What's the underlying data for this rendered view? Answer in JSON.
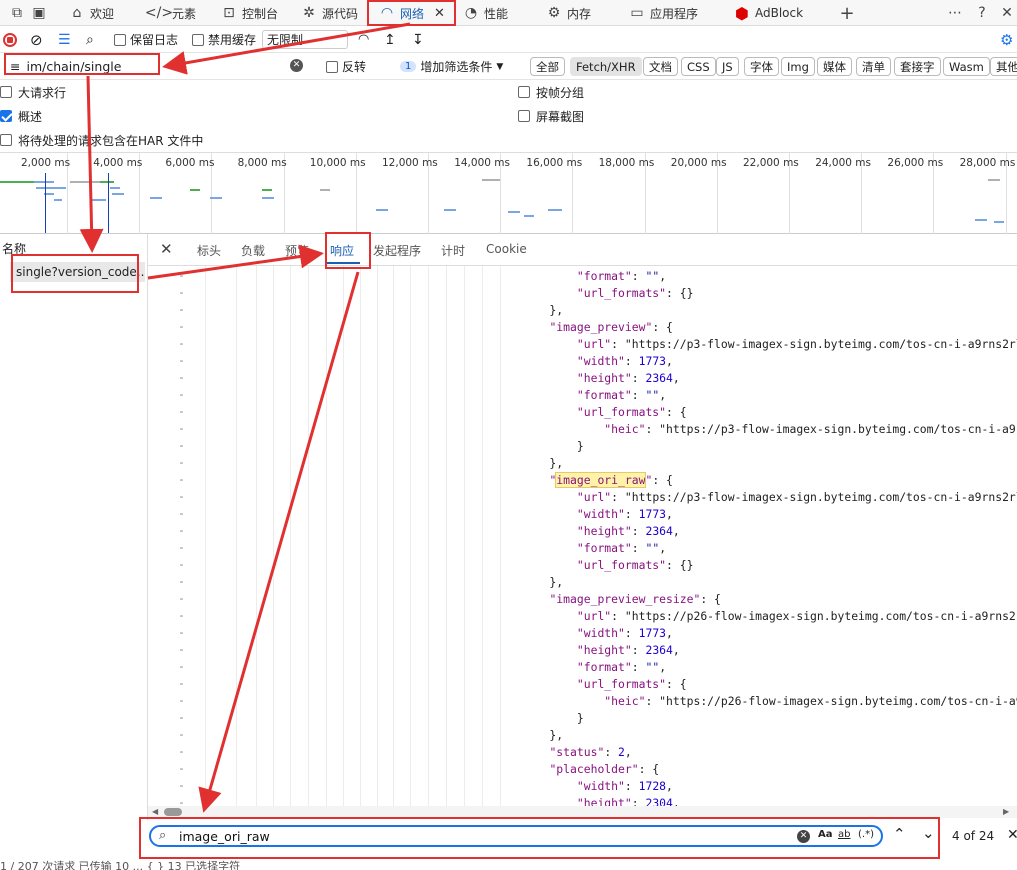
{
  "tabs": [
    {
      "label": "欢迎",
      "icon": "home-icon"
    },
    {
      "label": "元素",
      "icon": "code-icon"
    },
    {
      "label": "控制台",
      "icon": "console-icon"
    },
    {
      "label": "源代码",
      "icon": "bug-icon"
    },
    {
      "label": "网络",
      "icon": "wifi-icon"
    },
    {
      "label": "性能",
      "icon": "gauge-icon"
    },
    {
      "label": "内存",
      "icon": "memory-icon"
    },
    {
      "label": "应用程序",
      "icon": "app-icon"
    },
    {
      "label": "AdBlock",
      "icon": "adblock-icon"
    }
  ],
  "toolbar": {
    "preserve_log": "保留日志",
    "disable_cache": "禁用缓存",
    "throttle": "无限制"
  },
  "filter": {
    "value": "im/chain/single",
    "invert": "反转",
    "more_filters_count": "1",
    "more_filters": "增加筛选条件",
    "types": [
      "全部",
      "Fetch/XHR",
      "文档",
      "CSS",
      "JS",
      "字体",
      "Img",
      "媒体",
      "清单",
      "套接字",
      "Wasm",
      "其他"
    ]
  },
  "options": {
    "large_rows": "大请求行",
    "overview": "概述",
    "har": "将待处理的请求包含在HAR 文件中",
    "group_by_frame": "按帧分组",
    "screenshots": "屏幕截图"
  },
  "timeline": {
    "ticks": [
      "2,000 ms",
      "4,000 ms",
      "6,000 ms",
      "8,000 ms",
      "10,000 ms",
      "12,000 ms",
      "14,000 ms",
      "16,000 ms",
      "18,000 ms",
      "20,000 ms",
      "22,000 ms",
      "24,000 ms",
      "26,000 ms",
      "28,000 ms"
    ]
  },
  "requests": {
    "header": "名称",
    "selected": "single?version_code..."
  },
  "detail_tabs": [
    "标头",
    "负载",
    "预览",
    "响应",
    "发起程序",
    "计时",
    "Cookie"
  ],
  "code_lines": [
    "        \"format\": \"\",",
    "        \"url_formats\": {}",
    "    },",
    "    \"image_preview\": {",
    "        \"url\": \"https://p3-flow-imagex-sign.byteimg.com/tos-cn-i-a9rns2rl98/rc_",
    "        \"width\": 1773,",
    "        \"height\": 2364,",
    "        \"format\": \"\",",
    "        \"url_formats\": {",
    "            \"heic\": \"https://p3-flow-imagex-sign.byteimg.com/tos-cn-i-a9rns2rl9",
    "        }",
    "    },",
    "    \"image_ori_raw\": {",
    "        \"url\": \"https://p3-flow-imagex-sign.byteimg.com/tos-cn-i-a9rns2rl98/rc_",
    "        \"width\": 1773,",
    "        \"height\": 2364,",
    "        \"format\": \"\",",
    "        \"url_formats\": {}",
    "    },",
    "    \"image_preview_resize\": {",
    "        \"url\": \"https://p26-flow-imagex-sign.byteimg.com/tos-cn-i-a9rns2rl98/r",
    "        \"width\": 1773,",
    "        \"height\": 2364,",
    "        \"format\": \"\",",
    "        \"url_formats\": {",
    "            \"heic\": \"https://p26-flow-imagex-sign.byteimg.com/tos-cn-i-a9rns2r",
    "        }",
    "    },",
    "    \"status\": 2,",
    "    \"placeholder\": {",
    "        \"width\": 1728,",
    "        \"height\": 2304,"
  ],
  "search": {
    "value": "image_ori_raw",
    "match_case": "Aa",
    "whole_word": "ab",
    "regex": "(.*)",
    "count": "4 of 24"
  },
  "status": {
    "text": "1 / 207 次请求  已传输 10 ...  { }  13 已选择字符"
  },
  "colors": {
    "accent": "#1a73e8",
    "annotation": "#e03030",
    "highlight": "#fff3a8"
  }
}
